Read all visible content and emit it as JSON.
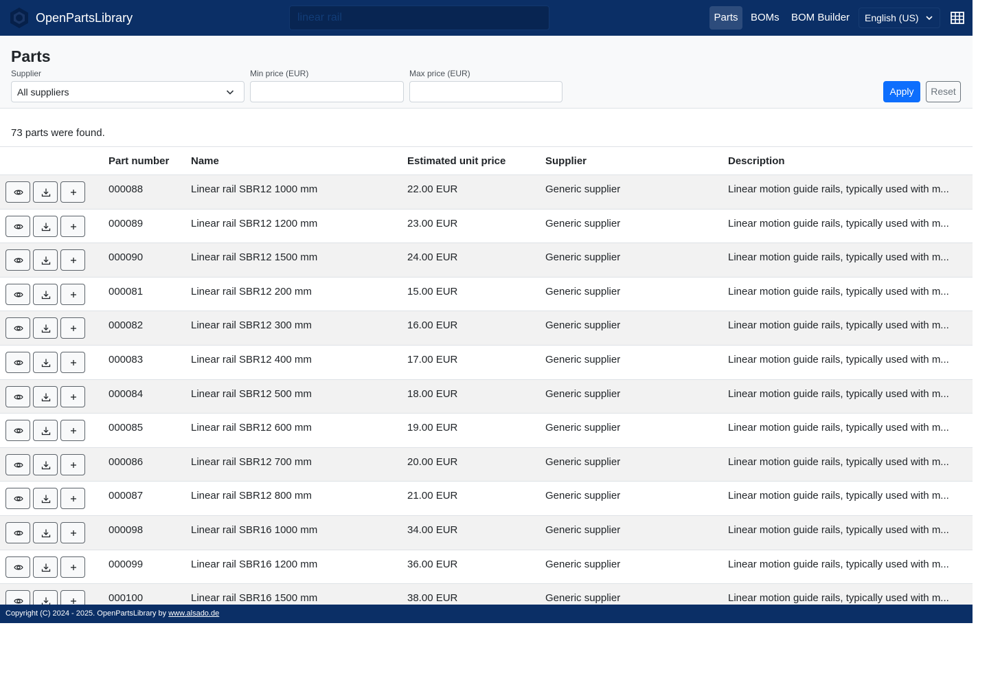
{
  "navbar": {
    "brand": "OpenPartsLibrary",
    "search_placeholder": "linear rail",
    "links": {
      "parts": "Parts",
      "boms": "BOMs",
      "bom_builder": "BOM Builder"
    },
    "language": "English (US)"
  },
  "filters": {
    "title": "Parts",
    "supplier_label": "Supplier",
    "supplier_value": "All suppliers",
    "min_price_label": "Min price (EUR)",
    "max_price_label": "Max price (EUR)",
    "apply": "Apply",
    "reset": "Reset"
  },
  "results": {
    "count_text": "73 parts were found."
  },
  "table": {
    "headers": [
      "",
      "Part number",
      "Name",
      "Estimated unit price",
      "Supplier",
      "Description"
    ],
    "rows": [
      {
        "part_number": "000088",
        "name": "Linear rail SBR12 1000 mm",
        "price": "22.00 EUR",
        "supplier": "Generic supplier",
        "description": "Linear motion guide rails, typically used with m..."
      },
      {
        "part_number": "000089",
        "name": "Linear rail SBR12 1200 mm",
        "price": "23.00 EUR",
        "supplier": "Generic supplier",
        "description": "Linear motion guide rails, typically used with m..."
      },
      {
        "part_number": "000090",
        "name": "Linear rail SBR12 1500 mm",
        "price": "24.00 EUR",
        "supplier": "Generic supplier",
        "description": "Linear motion guide rails, typically used with m..."
      },
      {
        "part_number": "000081",
        "name": "Linear rail SBR12 200 mm",
        "price": "15.00 EUR",
        "supplier": "Generic supplier",
        "description": "Linear motion guide rails, typically used with m..."
      },
      {
        "part_number": "000082",
        "name": "Linear rail SBR12 300 mm",
        "price": "16.00 EUR",
        "supplier": "Generic supplier",
        "description": "Linear motion guide rails, typically used with m..."
      },
      {
        "part_number": "000083",
        "name": "Linear rail SBR12 400 mm",
        "price": "17.00 EUR",
        "supplier": "Generic supplier",
        "description": "Linear motion guide rails, typically used with m..."
      },
      {
        "part_number": "000084",
        "name": "Linear rail SBR12 500 mm",
        "price": "18.00 EUR",
        "supplier": "Generic supplier",
        "description": "Linear motion guide rails, typically used with m..."
      },
      {
        "part_number": "000085",
        "name": "Linear rail SBR12 600 mm",
        "price": "19.00 EUR",
        "supplier": "Generic supplier",
        "description": "Linear motion guide rails, typically used with m..."
      },
      {
        "part_number": "000086",
        "name": "Linear rail SBR12 700 mm",
        "price": "20.00 EUR",
        "supplier": "Generic supplier",
        "description": "Linear motion guide rails, typically used with m..."
      },
      {
        "part_number": "000087",
        "name": "Linear rail SBR12 800 mm",
        "price": "21.00 EUR",
        "supplier": "Generic supplier",
        "description": "Linear motion guide rails, typically used with m..."
      },
      {
        "part_number": "000098",
        "name": "Linear rail SBR16 1000 mm",
        "price": "34.00 EUR",
        "supplier": "Generic supplier",
        "description": "Linear motion guide rails, typically used with m..."
      },
      {
        "part_number": "000099",
        "name": "Linear rail SBR16 1200 mm",
        "price": "36.00 EUR",
        "supplier": "Generic supplier",
        "description": "Linear motion guide rails, typically used with m..."
      },
      {
        "part_number": "000100",
        "name": "Linear rail SBR16 1500 mm",
        "price": "38.00 EUR",
        "supplier": "Generic supplier",
        "description": "Linear motion guide rails, typically used with m..."
      }
    ]
  },
  "footer": {
    "copyright": "Copyright (C) 2024 - 2025. OpenPartsLibrary by ",
    "link": "www.alsado.de"
  },
  "icons": {
    "brand": "hexagon-logo-icon",
    "language_chevron": "chevron-down-icon",
    "grid": "table-grid-icon",
    "row_actions": [
      "eye-icon",
      "download-icon",
      "plus-icon"
    ]
  },
  "colors": {
    "navbar": "#0b2f66",
    "primary": "#0d6efd",
    "stripe": "#f2f2f2"
  }
}
